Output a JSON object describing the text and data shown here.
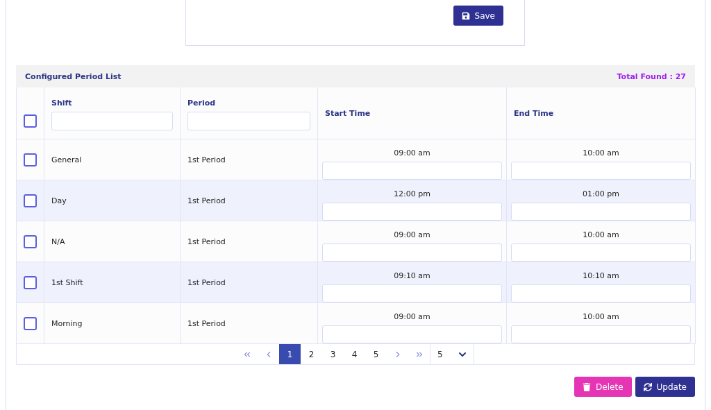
{
  "form": {
    "save_button": "Save"
  },
  "list": {
    "title": "Configured Period List",
    "total": "Total Found : 27",
    "columns": [
      {
        "label": "Shift",
        "filter": true
      },
      {
        "label": "Period",
        "filter": true
      },
      {
        "label": "Start Time",
        "filter": false
      },
      {
        "label": "End Time",
        "filter": false
      }
    ],
    "header_checked": false,
    "rows": [
      {
        "checked": false,
        "shift": "General",
        "period": "1st Period",
        "start": "09:00 am",
        "end": "10:00 am"
      },
      {
        "checked": false,
        "shift": "Day",
        "period": "1st Period",
        "start": "12:00 pm",
        "end": "01:00 pm"
      },
      {
        "checked": false,
        "shift": "N/A",
        "period": "1st Period",
        "start": "09:00 am",
        "end": "10:00 am"
      },
      {
        "checked": false,
        "shift": "1st Shift",
        "period": "1st Period",
        "start": "09:10 am",
        "end": "10:10 am"
      },
      {
        "checked": false,
        "shift": "Morning",
        "period": "1st Period",
        "start": "09:00 am",
        "end": "10:00 am"
      }
    ],
    "pagination": {
      "pages": [
        {
          "label": "1",
          "selected": true
        },
        {
          "label": "2",
          "selected": false
        },
        {
          "label": "3",
          "selected": false
        },
        {
          "label": "4",
          "selected": false
        },
        {
          "label": "5",
          "selected": false
        }
      ],
      "page_size": "5"
    }
  },
  "actions": {
    "delete": "Delete",
    "update": "Update"
  }
}
